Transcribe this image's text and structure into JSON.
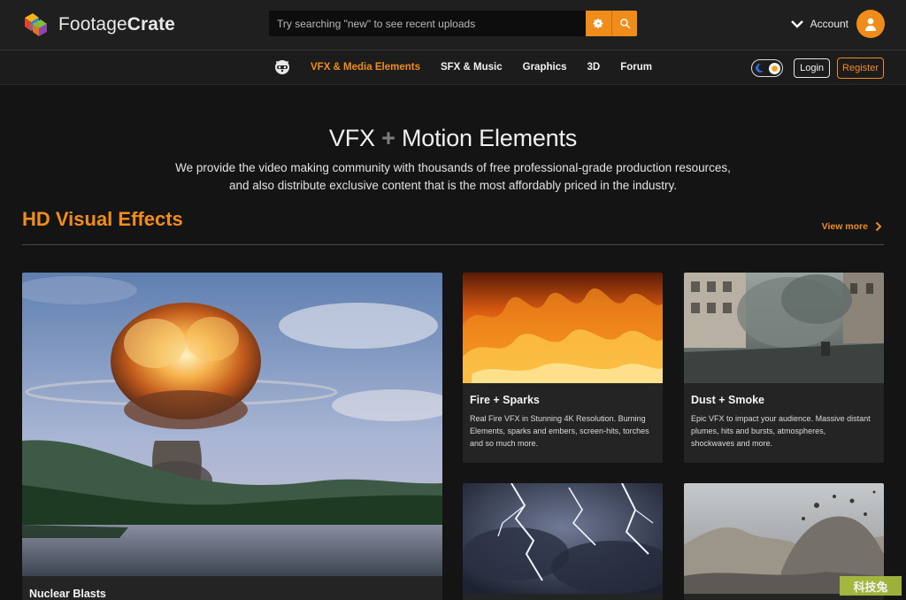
{
  "brand": {
    "name_part1": "Footage",
    "name_part2": "Crate"
  },
  "search": {
    "placeholder": "Try searching \"new\" to see recent uploads",
    "value": ""
  },
  "account": {
    "label": "Account"
  },
  "nav": {
    "items": [
      "VFX & Media Elements",
      "SFX & Music",
      "Graphics",
      "3D",
      "Forum"
    ],
    "active_index": 0,
    "login_label": "Login",
    "register_label": "Register"
  },
  "hero": {
    "title_left": "VFX",
    "title_plus": "+",
    "title_right": "Motion Elements",
    "description_line1": "We provide the video making community with thousands of free professional-grade production resources,",
    "description_line2": "and also distribute exclusive content that is the most affordably priced in the industry."
  },
  "section": {
    "title": "HD Visual Effects",
    "view_more": "View more"
  },
  "cards": [
    {
      "title": "Nuclear Blasts",
      "description": ""
    },
    {
      "title": "Fire + Sparks",
      "description_lines": [
        "Real Fire VFX in Stunning 4K Resolution. Burning",
        "Elements, sparks and embers, screen-hits, torches",
        "and so much more."
      ]
    },
    {
      "title": "Dust + Smoke",
      "description_lines": [
        "Epic VFX to impact your audience. Massive distant",
        "plumes, hits and bursts, atmospheres,",
        "shockwaves and more."
      ]
    },
    {
      "title": "",
      "description": ""
    },
    {
      "title": "",
      "description": ""
    }
  ],
  "watermark": "科技兔",
  "colors": {
    "accent": "#f08d1a",
    "background": "#141414",
    "card": "#242424",
    "topbar": "#1f1f1f"
  },
  "icons": [
    "logo-cube-icon",
    "gear-icon",
    "search-icon",
    "chevron-down-icon",
    "user-icon",
    "raccoon-mascot-icon",
    "moon-icon",
    "sun-icon",
    "chevron-right-icon"
  ]
}
